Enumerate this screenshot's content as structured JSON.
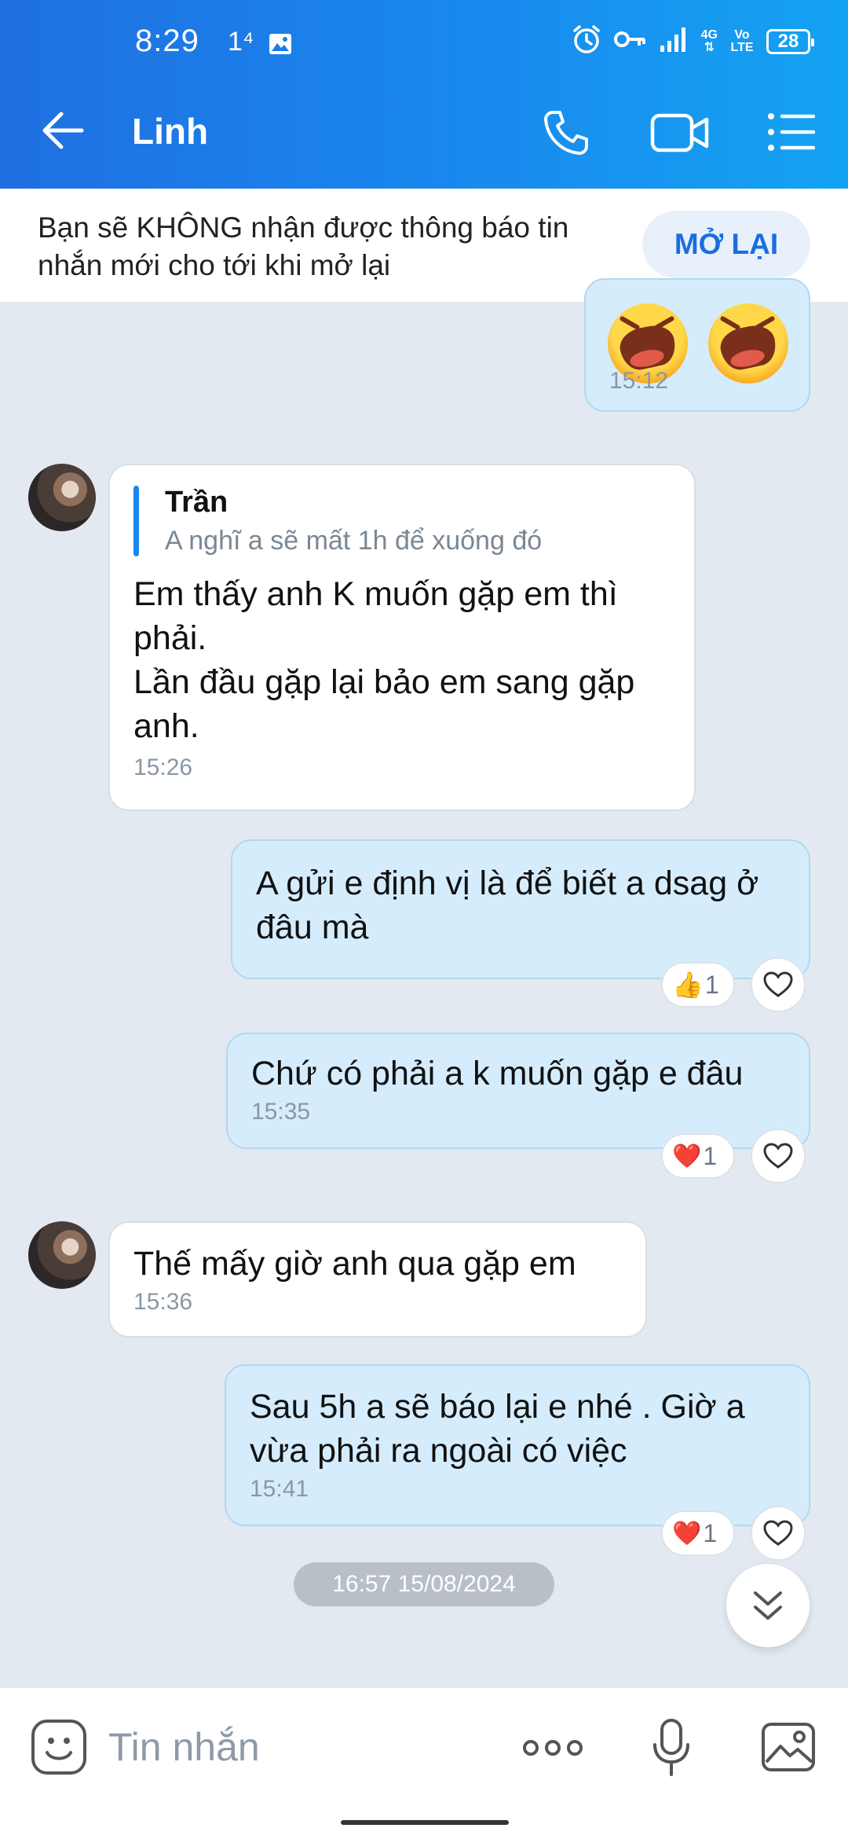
{
  "status": {
    "time": "8:29",
    "network_small": "1⁴",
    "net_type": "4G",
    "volte": "Vo LTE",
    "battery": "28"
  },
  "header": {
    "title": "Linh"
  },
  "notice": {
    "text": "Bạn sẽ KHÔNG nhận được thông báo tin nhắn mới cho tới khi mở lại",
    "button": "MỞ LẠI"
  },
  "messages": [
    {
      "dir": "out",
      "type": "sticker",
      "time": "15:12"
    },
    {
      "dir": "in",
      "reply_name": "Trần",
      "reply_text": "A nghĩ a sẽ mất 1h để xuống đó",
      "text": "Em thấy anh K muốn gặp em thì phải.\nLần đầu gặp lại bảo em sang gặp anh.",
      "time": "15:26"
    },
    {
      "dir": "out",
      "text": "A gửi e định vị là để biết a dsag ở đâu mà",
      "reaction": "👍",
      "reaction_count": "1"
    },
    {
      "dir": "out",
      "text": "Chứ có phải a k muốn gặp e đâu",
      "time": "15:35",
      "reaction": "❤️",
      "reaction_count": "1"
    },
    {
      "dir": "in",
      "text": "Thế mấy giờ anh qua gặp em",
      "time": "15:36"
    },
    {
      "dir": "out",
      "text": "Sau 5h a sẽ báo lại e nhé . Giờ a vừa phải ra ngoài có việc",
      "time": "15:41",
      "reaction": "❤️",
      "reaction_count": "1"
    }
  ],
  "date_separator": "16:57 15/08/2024",
  "composer": {
    "placeholder": "Tin nhắn"
  },
  "colors": {
    "header_start": "#1f6fe0",
    "header_end": "#14a3f2",
    "bubble_out": "#d5ecfd",
    "bubble_in": "#ffffff",
    "chat_bg": "#e2e9f1",
    "accent": "#1a6ee0"
  }
}
